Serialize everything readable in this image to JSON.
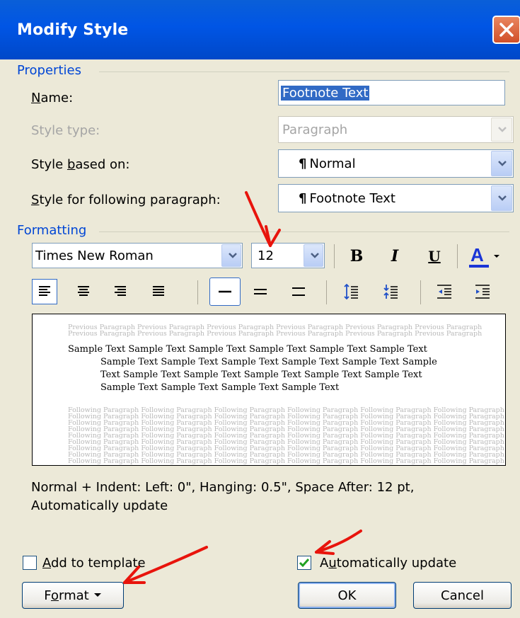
{
  "window": {
    "title": "Modify Style"
  },
  "properties": {
    "group_label": "Properties",
    "name_label": "Name:",
    "name_value": "Footnote Text",
    "style_type_label": "Style type:",
    "style_type_value": "Paragraph",
    "based_on_label": "Style based on:",
    "based_on_value": "Normal",
    "following_label": "Style for following paragraph:",
    "following_value": "Footnote Text",
    "pilcrow": "¶"
  },
  "formatting": {
    "group_label": "Formatting",
    "font_name": "Times New Roman",
    "font_size": "12",
    "bold": "B",
    "italic": "I",
    "underline": "U",
    "font_color_glyph": "A",
    "font_color": "#1a35d6"
  },
  "preview": {
    "previous_line": "Previous Paragraph Previous Paragraph Previous Paragraph Previous Paragraph Previous Paragraph Previous Paragraph",
    "previous_line2": "Previous Paragraph Previous Paragraph Previous Paragraph Previous Paragraph Previous Paragraph Previous Paragraph",
    "sample_lines": [
      "Sample Text Sample Text Sample Text Sample Text Sample Text Sample Text",
      "Sample Text Sample Text Sample Text Sample Text Sample Text Sample",
      "Text Sample Text Sample Text Sample Text Sample Text Sample Text",
      "Sample Text Sample Text Sample Text Sample Text"
    ],
    "following_line": "Following Paragraph Following Paragraph Following Paragraph Following Paragraph Following Paragraph Following Paragraph"
  },
  "description": "Normal + Indent: Left:  0\", Hanging:  0.5\", Space After:  12 pt, Automatically update",
  "options": {
    "add_to_template_label": "Add to template",
    "add_to_template_checked": false,
    "auto_update_label": "Automatically update",
    "auto_update_checked": true
  },
  "buttons": {
    "format": "Format",
    "ok": "OK",
    "cancel": "Cancel"
  },
  "colors": {
    "annotation_arrow": "#e8140c",
    "titlebar": "#0055e5",
    "group_label": "#0046d5"
  }
}
